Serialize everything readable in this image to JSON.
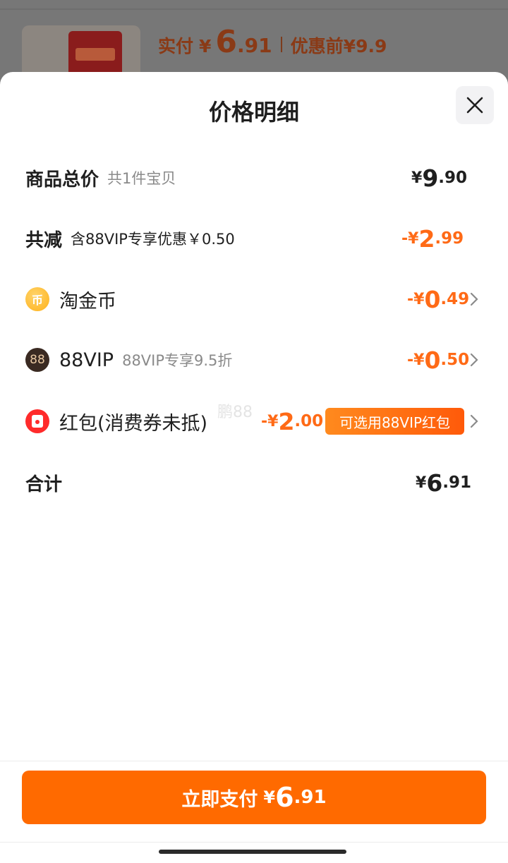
{
  "background": {
    "paid_label": "实付",
    "paid_yen": "¥",
    "paid_big": "6",
    "paid_small": ".91",
    "original_label": "优惠前",
    "original_value": "¥9.9"
  },
  "sheet": {
    "title": "价格明细",
    "close_icon": "close-icon"
  },
  "rows": {
    "subtotal": {
      "label": "商品总价",
      "sub": "共1件宝贝",
      "yen": "¥",
      "big": "9",
      "small": ".90"
    },
    "discount": {
      "label": "共减",
      "sub": "含88VIP专享优惠￥0.50",
      "prefix": "-",
      "yen": "¥",
      "big": "2",
      "small": ".99"
    },
    "coins": {
      "icon": "coin-icon",
      "icon_text": "币",
      "label": "淘金币",
      "prefix": "-",
      "yen": "¥",
      "big": "0",
      "small": ".49"
    },
    "vip": {
      "icon": "vip-icon",
      "icon_text": "88",
      "label": "88VIP",
      "sub": "88VIP专享9.5折",
      "prefix": "-",
      "yen": "¥",
      "big": "0",
      "small": ".50"
    },
    "redpacket": {
      "icon": "red-packet-icon",
      "label": "红包(消费券未抵)",
      "prefix": "-",
      "yen": "¥",
      "big": "2",
      "small": ".00",
      "badge": "可选用88VIP红包"
    },
    "total": {
      "label": "合计",
      "yen": "¥",
      "big": "6",
      "small": ".91"
    }
  },
  "watermark": "鹏88",
  "footer": {
    "pay_label": "立即支付",
    "pay_yen": "¥",
    "pay_big": "6",
    "pay_small": ".91"
  },
  "colors": {
    "accent": "#ff6a00",
    "discount_text": "#ff6a16",
    "text": "#1f1f1f",
    "muted": "#8a8a8a"
  }
}
